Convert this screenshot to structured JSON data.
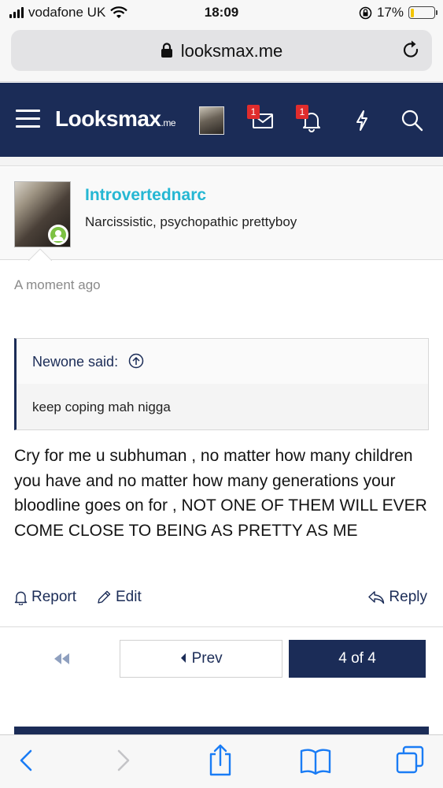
{
  "status_bar": {
    "carrier": "vodafone UK",
    "time": "18:09",
    "battery": "17%",
    "battery_level": 0.17
  },
  "browser": {
    "url": "looksmax.me"
  },
  "site_header": {
    "logo_main": "Looksmax",
    "logo_suffix": ".me",
    "inbox_badge": "1",
    "alerts_badge": "1"
  },
  "post": {
    "username": "Introvertednarc",
    "user_title": "Narcissistic, psychopathic prettyboy",
    "timestamp": "A moment ago",
    "quote_author": "Newone said:",
    "quote_text": "keep coping mah nigga",
    "message": "Cry for me u subhuman , no matter how many children you have and no matter how many generations your bloodline goes on for , NOT ONE OF THEM WILL EVER COME CLOSE TO BEING AS PRETTY AS ME",
    "actions": {
      "report": "Report",
      "edit": "Edit",
      "reply": "Reply"
    }
  },
  "pagination": {
    "prev": "Prev",
    "current": "4 of 4"
  },
  "colors": {
    "header_bg": "#1b2c57",
    "username": "#25b7d3",
    "link": "#1b2c57",
    "online": "#7cc142",
    "badge": "#e02c2c",
    "toolbar_icons": "#1a7cf5"
  }
}
